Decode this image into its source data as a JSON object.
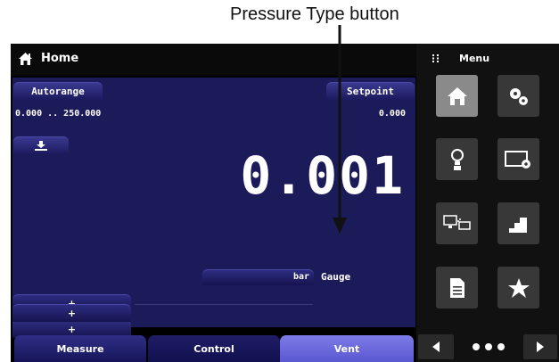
{
  "annotation": {
    "label": "Pressure Type button"
  },
  "topbar": {
    "title": "Home",
    "home_icon": "home-icon"
  },
  "main": {
    "autorange_label": "Autorange",
    "range_text": "0.000 .. 250.000",
    "setpoint_label": "Setpoint",
    "setpoint_value": "0.000",
    "download_icon": "download-icon",
    "reading": "0.001",
    "unit": "bar",
    "pressure_type": "Gauge",
    "aux_buttons": [
      "+",
      "+",
      "+"
    ]
  },
  "tabs": {
    "measure": "Measure",
    "control": "Control",
    "vent": "Vent"
  },
  "menu": {
    "title": "Menu",
    "items": [
      "home-icon",
      "settings-gears-icon",
      "sensor-icon",
      "display-settings-icon",
      "remote-communication-icon",
      "step-program-icon",
      "document-icon",
      "favorites-star-icon"
    ],
    "nav": [
      "previous-arrow-icon",
      "more-dots-icon",
      "next-arrow-icon"
    ]
  },
  "colors": {
    "main_bg": "#1c1b5a",
    "accent_tab": "#6e6ce0",
    "menu_selected": "#8a8a8a"
  }
}
